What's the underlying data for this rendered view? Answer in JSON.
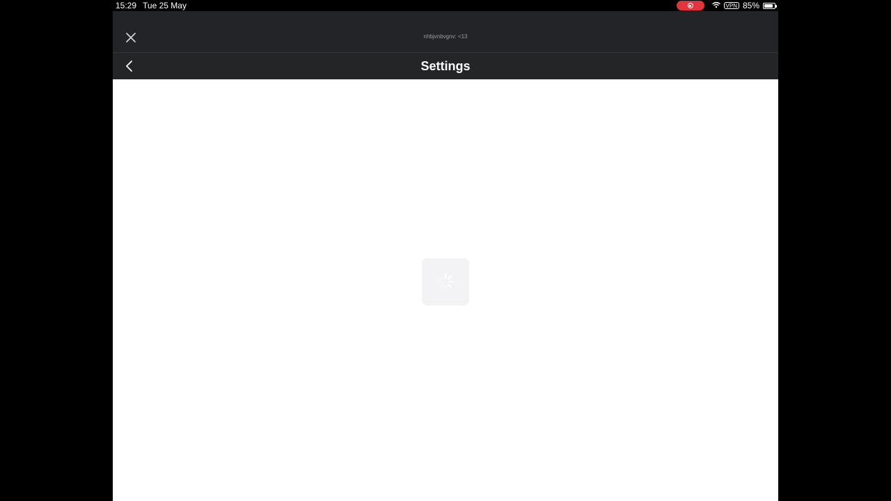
{
  "status_bar": {
    "time": "15:29",
    "date": "Tue 25 May",
    "vpn": "VPN",
    "battery": "85%",
    "battery_level": 0.85,
    "recording_color": "#e0353c"
  },
  "top_bar": {
    "title": "nhbjvnbvgnv: <13",
    "close_icon": "close-icon"
  },
  "header": {
    "title": "Settings",
    "back_icon": "chevron-left-icon"
  },
  "content": {
    "loading_icon": "spinner-icon"
  },
  "colors": {
    "bar_background": "#222428",
    "header_background": "#232527",
    "content_background": "#ffffff",
    "loader_background": "#f3f2f5"
  }
}
